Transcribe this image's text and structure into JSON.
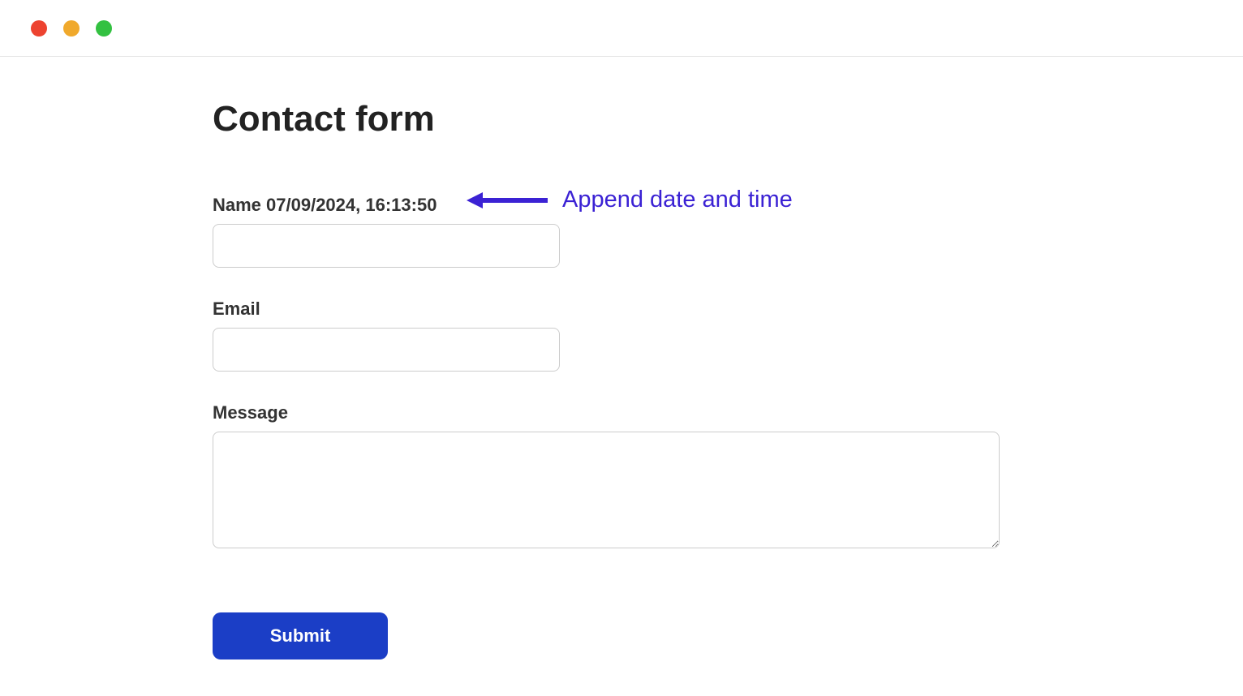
{
  "form": {
    "title": "Contact form",
    "name_label": "Name 07/09/2024, 16:13:50",
    "name_value": "",
    "email_label": "Email",
    "email_value": "",
    "message_label": "Message",
    "message_value": "",
    "submit_label": "Submit"
  },
  "annotation": {
    "text": "Append date and time",
    "color": "#3b22d4"
  }
}
